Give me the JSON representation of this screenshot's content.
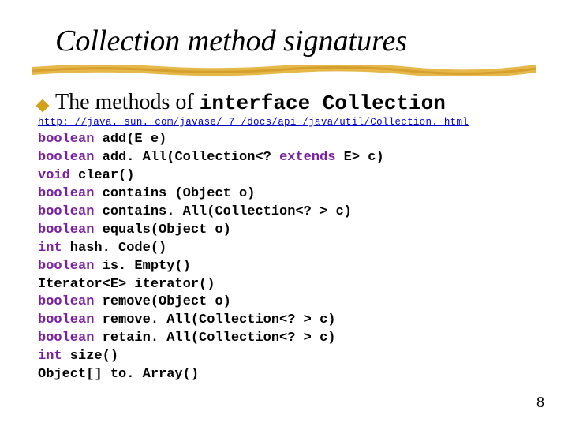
{
  "title": "Collection method signatures",
  "bullet": {
    "prefix": "The methods of ",
    "code": "interface Collection"
  },
  "link": "http: //java. sun. com/javase/ 7 /docs/api /java/util/Collection. html",
  "code_lines": [
    {
      "ret": "boolean",
      "rest": " add(E e)"
    },
    {
      "ret": "boolean",
      "rest": " add. All(Collection<? ",
      "kw2": "extends",
      "rest2": " E> c)"
    },
    {
      "ret": "void",
      "rest": " clear()"
    },
    {
      "ret": "boolean",
      "rest": " contains (Object o)"
    },
    {
      "ret": "boolean",
      "rest": " contains. All(Collection<? > c)"
    },
    {
      "ret": "boolean",
      "rest": " equals(Object o)"
    },
    {
      "ret": "int",
      "rest": " hash. Code()"
    },
    {
      "ret": "boolean",
      "rest": " is. Empty()"
    },
    {
      "ret": "",
      "rest": "Iterator<E> iterator()"
    },
    {
      "ret": "boolean",
      "rest": " remove(Object o)"
    },
    {
      "ret": "boolean",
      "rest": " remove. All(Collection<? > c)"
    },
    {
      "ret": "boolean",
      "rest": " retain. All(Collection<? > c)"
    },
    {
      "ret": "int",
      "rest": " size()"
    },
    {
      "ret": "",
      "rest": "Object[] to. Array()"
    }
  ],
  "page_number": "8"
}
